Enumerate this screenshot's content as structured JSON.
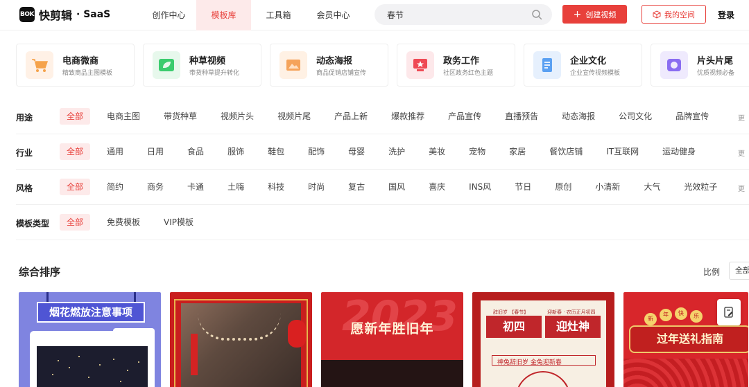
{
  "header": {
    "logo_mark": "BOK",
    "logo_text": "快剪辑",
    "logo_saas": "· SaaS",
    "nav": [
      {
        "label": "创作中心",
        "active": false
      },
      {
        "label": "模板库",
        "active": true
      },
      {
        "label": "工具箱",
        "active": false
      },
      {
        "label": "会员中心",
        "active": false
      }
    ],
    "search_value": "春节",
    "create_label": "创建视频",
    "space_label": "我的空间",
    "login_label": "登录"
  },
  "cards": [
    {
      "title": "电商微商",
      "sub": "精致商品主图模板",
      "icon": "cart-icon",
      "bg": "#fff1e6",
      "fg": "#f5a24a"
    },
    {
      "title": "种草视频",
      "sub": "带货种草提升转化",
      "icon": "leaf-icon",
      "bg": "#e7f8ec",
      "fg": "#3bcc6e"
    },
    {
      "title": "动态海报",
      "sub": "商品促销店铺宣传",
      "icon": "poster-icon",
      "bg": "#fff1e4",
      "fg": "#f5a35a"
    },
    {
      "title": "政务工作",
      "sub": "社区政务红色主题",
      "icon": "star-badge-icon",
      "bg": "#fde8ea",
      "fg": "#ef4a55"
    },
    {
      "title": "企业文化",
      "sub": "企业宣传视频模板",
      "icon": "document-icon",
      "bg": "#e6f0fd",
      "fg": "#5aa0f2"
    },
    {
      "title": "片头片尾",
      "sub": "优质视频必备",
      "icon": "play-icon",
      "bg": "#efeafd",
      "fg": "#8a6df1"
    }
  ],
  "filters": [
    {
      "label": "用途",
      "tags": [
        "全部",
        "电商主图",
        "带货种草",
        "视频片头",
        "视频片尾",
        "产品上新",
        "爆款推荐",
        "产品宣传",
        "直播预告",
        "动态海报",
        "公司文化",
        "品牌宣传"
      ],
      "more": "更"
    },
    {
      "label": "行业",
      "tags": [
        "全部",
        "通用",
        "日用",
        "食品",
        "服饰",
        "鞋包",
        "配饰",
        "母婴",
        "洗护",
        "美妆",
        "宠物",
        "家居",
        "餐饮店铺",
        "IT互联网",
        "运动健身"
      ],
      "more": "更"
    },
    {
      "label": "风格",
      "tags": [
        "全部",
        "简约",
        "商务",
        "卡通",
        "土嗨",
        "科技",
        "时尚",
        "复古",
        "国风",
        "喜庆",
        "INS风",
        "节日",
        "原创",
        "小清新",
        "大气",
        "光效粒子"
      ],
      "more": "更"
    },
    {
      "label": "模板类型",
      "tags": [
        "全部",
        "免费模板",
        "VIP模板"
      ],
      "more": ""
    }
  ],
  "sort": {
    "title": "综合排序",
    "ratio_label": "比例",
    "ratio_value": "全部"
  },
  "thumbs": {
    "t1_title": "烟花燃放注意事项",
    "t3_big": "2023",
    "t3_title": "愿新年胜旧年",
    "t4_small_left": "辞旧岁 【春节】",
    "t4_small_right": "迎新春 · 农历正月初四",
    "t4_tile_left": "初四",
    "t4_tile_right": "迎灶神",
    "t4_sub": "神兔辞旧岁  金兔迎新春",
    "t5_title": "过年送礼指南",
    "t5_badges": [
      "新",
      "年",
      "快",
      "乐"
    ]
  },
  "colors": {
    "accent": "#e8403b"
  }
}
